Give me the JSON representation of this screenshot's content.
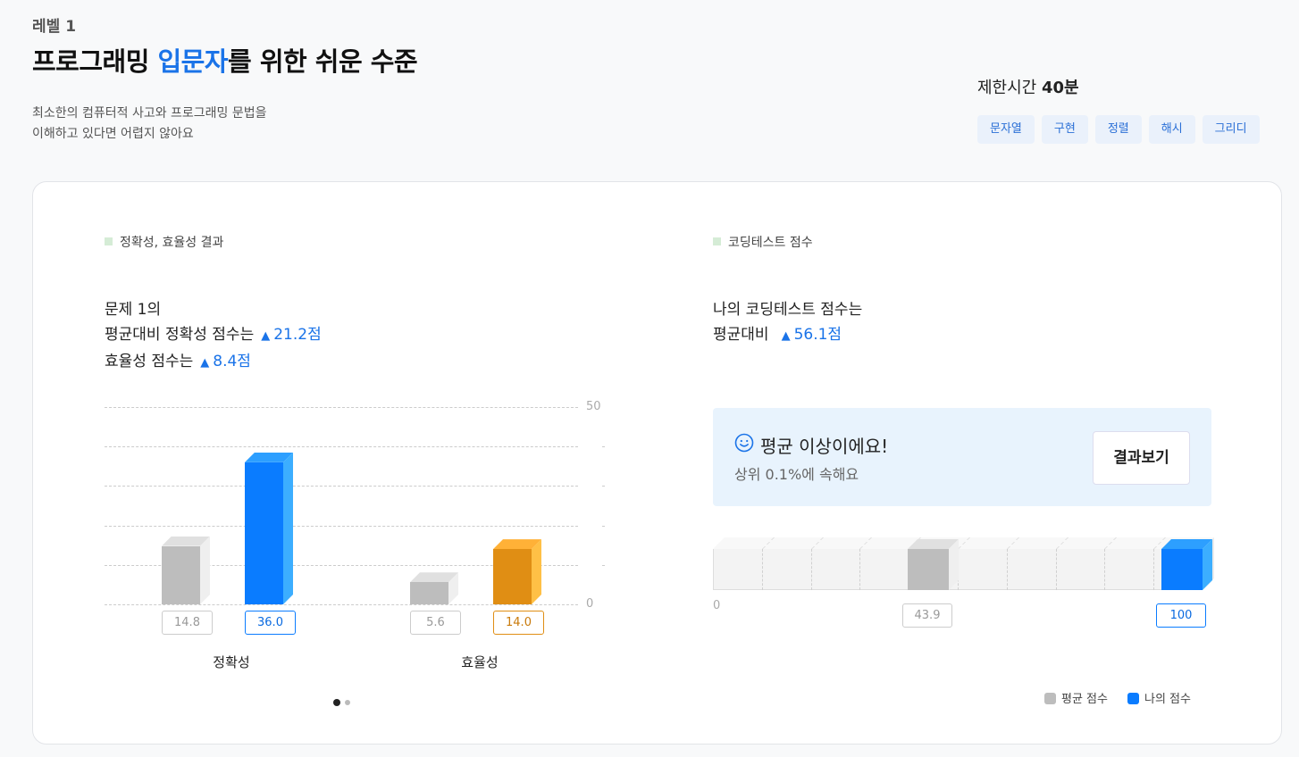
{
  "header": {
    "level": "레벨 1",
    "title_pre": "프로그래밍 ",
    "title_hl": "입문자",
    "title_post": "를 위한 쉬운 수준",
    "desc_line1": "최소한의 컴퓨터적 사고와 프로그래밍 문법을",
    "desc_line2": "이해하고 있다면 어렵지 않아요",
    "time_label": "제한시간 ",
    "time_value": "40분",
    "tags": [
      "문자열",
      "구현",
      "정렬",
      "해시",
      "그리디"
    ]
  },
  "left": {
    "section_label": "정확성, 효율성 결과",
    "summary_line1": "문제 1의",
    "summary_line2": "평균대비 정확성 점수는",
    "accuracy_delta": "21.2점",
    "summary_line3": "효율성 점수는",
    "efficiency_delta": "8.4점",
    "up_arrow": "▲",
    "page_dots": 2,
    "active_page": 1
  },
  "right": {
    "section_label": "코딩테스트 점수",
    "summary_line1": "나의 코딩테스트 점수는",
    "summary_line2": "평균대비",
    "delta": "56.1점",
    "banner_title": "평균 이상이에요!",
    "banner_sub": "상위 0.1%에 속해요",
    "result_button": "결과보기",
    "icon": "smile-icon"
  },
  "legend": {
    "avg_label": "평균 점수",
    "mine_label": "나의 점수"
  },
  "colors": {
    "accent": "#1a73e8",
    "avg_bar": "#bdbdbd",
    "my_bar": "#0a7cff",
    "efficiency_bar": "#e08e14"
  },
  "chart_data": [
    {
      "type": "bar",
      "categories": [
        "정확성",
        "효율성"
      ],
      "series": [
        {
          "values": [
            14.8,
            5.6
          ],
          "value_labels": [
            "14.8",
            "5.6"
          ]
        },
        {
          "values": [
            36.0,
            14.0
          ],
          "value_labels": [
            "36.0",
            "14.0"
          ]
        }
      ],
      "ylim": [
        0,
        50
      ],
      "y_tick_labels": [
        "0",
        "50"
      ],
      "grid": true
    },
    {
      "type": "bar",
      "orientation": "horizontal",
      "xlim": [
        0,
        100
      ],
      "x_tick_labels": [
        "0"
      ],
      "series": [
        {
          "name": "평균 점수",
          "value": 43.9,
          "value_label": "43.9"
        },
        {
          "name": "나의 점수",
          "value": 100,
          "value_label": "100"
        }
      ],
      "grid": true
    }
  ]
}
